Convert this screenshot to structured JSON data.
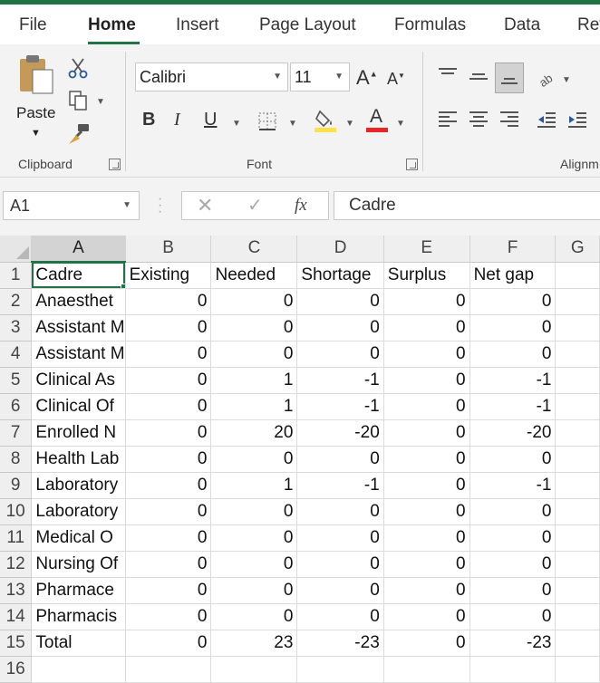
{
  "tabs": [
    "File",
    "Home",
    "Insert",
    "Page Layout",
    "Formulas",
    "Data",
    "Rev"
  ],
  "active_tab": "Home",
  "ribbon": {
    "clipboard_label": "Clipboard",
    "paste_label": "Paste",
    "font_label": "Font",
    "alignment_label": "Alignm",
    "font_name": "Calibri",
    "font_size": "11",
    "bold": "B",
    "italic": "I",
    "underline": "U",
    "font_color_letter": "A",
    "increase_font": "A",
    "decrease_font": "A",
    "font_color_accent": "#e8262a",
    "highlight_accent": "#ffe04b"
  },
  "formula_bar": {
    "name_box": "A1",
    "fx": "fx",
    "content": "Cadre"
  },
  "columns": [
    "A",
    "B",
    "C",
    "D",
    "E",
    "F",
    "G"
  ],
  "rows": [
    {
      "n": "1",
      "cells": [
        "Cadre",
        "Existing",
        "Needed",
        "Shortage",
        "Surplus",
        "Net gap",
        ""
      ]
    },
    {
      "n": "2",
      "cells": [
        "Anaesthet",
        "0",
        "0",
        "0",
        "0",
        "0",
        ""
      ]
    },
    {
      "n": "3",
      "cells": [
        "Assistant M",
        "0",
        "0",
        "0",
        "0",
        "0",
        ""
      ]
    },
    {
      "n": "4",
      "cells": [
        "Assistant M",
        "0",
        "0",
        "0",
        "0",
        "0",
        ""
      ]
    },
    {
      "n": "5",
      "cells": [
        "Clinical As",
        "0",
        "1",
        "-1",
        "0",
        "-1",
        ""
      ]
    },
    {
      "n": "6",
      "cells": [
        "Clinical Of",
        "0",
        "1",
        "-1",
        "0",
        "-1",
        ""
      ]
    },
    {
      "n": "7",
      "cells": [
        "Enrolled N",
        "0",
        "20",
        "-20",
        "0",
        "-20",
        ""
      ]
    },
    {
      "n": "8",
      "cells": [
        "Health Lab",
        "0",
        "0",
        "0",
        "0",
        "0",
        ""
      ]
    },
    {
      "n": "9",
      "cells": [
        "Laboratory",
        "0",
        "1",
        "-1",
        "0",
        "-1",
        ""
      ]
    },
    {
      "n": "10",
      "cells": [
        "Laboratory",
        "0",
        "0",
        "0",
        "0",
        "0",
        ""
      ]
    },
    {
      "n": "11",
      "cells": [
        "Medical O",
        "0",
        "0",
        "0",
        "0",
        "0",
        ""
      ]
    },
    {
      "n": "12",
      "cells": [
        "Nursing Of",
        "0",
        "0",
        "0",
        "0",
        "0",
        ""
      ]
    },
    {
      "n": "13",
      "cells": [
        "Pharmace",
        "0",
        "0",
        "0",
        "0",
        "0",
        ""
      ]
    },
    {
      "n": "14",
      "cells": [
        "Pharmacis",
        "0",
        "0",
        "0",
        "0",
        "0",
        ""
      ]
    },
    {
      "n": "15",
      "cells": [
        "Total",
        "0",
        "23",
        "-23",
        "0",
        "-23",
        ""
      ]
    },
    {
      "n": "16",
      "cells": [
        "",
        "",
        "",
        "",
        "",
        "",
        ""
      ]
    }
  ],
  "accent_color": "#217346"
}
